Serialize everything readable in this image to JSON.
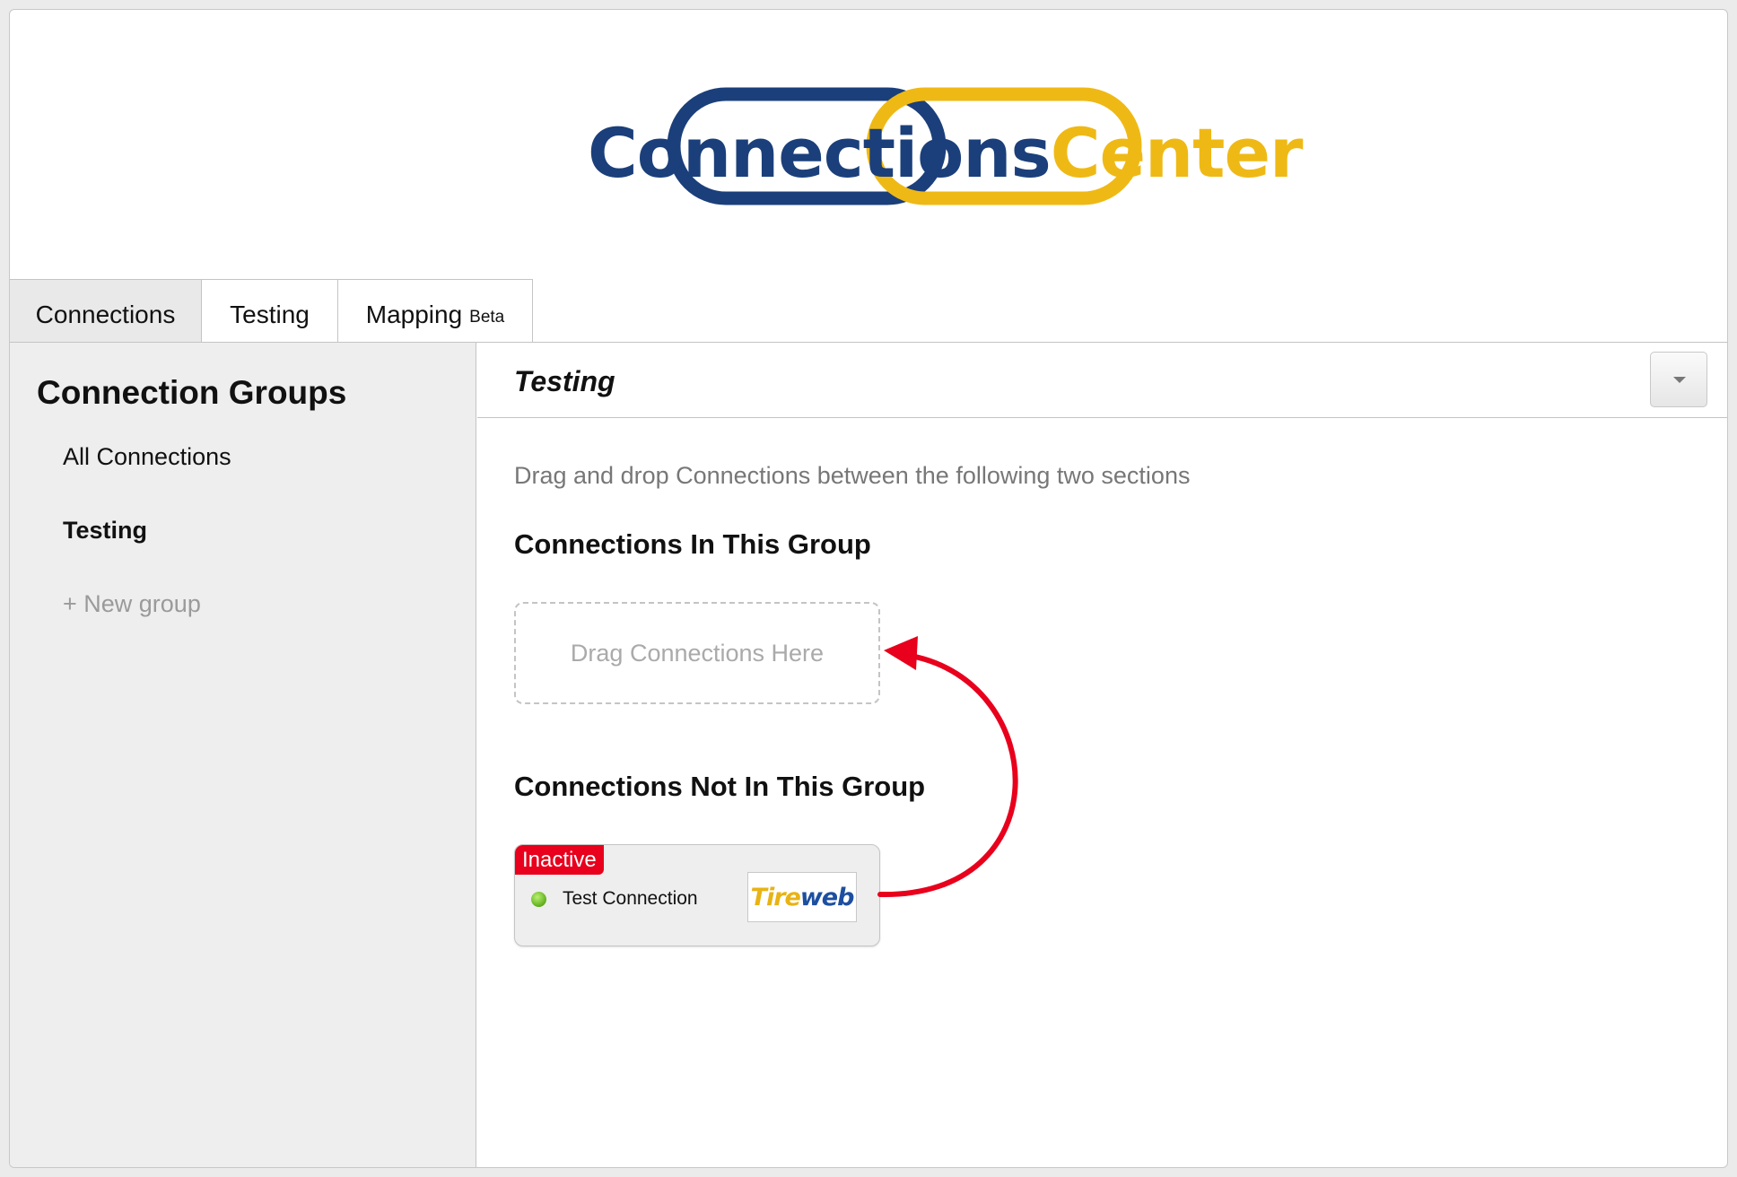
{
  "logo": {
    "word1": "Connections",
    "word2": "Center",
    "colors": {
      "blue": "#1b3f7a",
      "gold": "#efb915"
    }
  },
  "tabs": [
    {
      "label": "Connections"
    },
    {
      "label": "Testing"
    },
    {
      "label": "Mapping",
      "suffix": "Beta"
    }
  ],
  "sidebar": {
    "title": "Connection Groups",
    "items": [
      {
        "label": "All Connections"
      },
      {
        "label": "Testing",
        "selected": true
      },
      {
        "label": "+ New group"
      }
    ]
  },
  "main": {
    "title": "Testing",
    "instructions": "Drag and drop Connections between the following two sections",
    "in_group_heading": "Connections In This Group",
    "dropzone_text": "Drag Connections Here",
    "not_in_group_heading": "Connections Not In This Group",
    "connections": [
      {
        "status": "Inactive",
        "name": "Test Connection",
        "logo_part1": "Tire",
        "logo_part2": "web"
      }
    ]
  },
  "colors": {
    "badge": "#e8001c",
    "arrow": "#e8001c",
    "status_dot": "#5fae1c"
  }
}
